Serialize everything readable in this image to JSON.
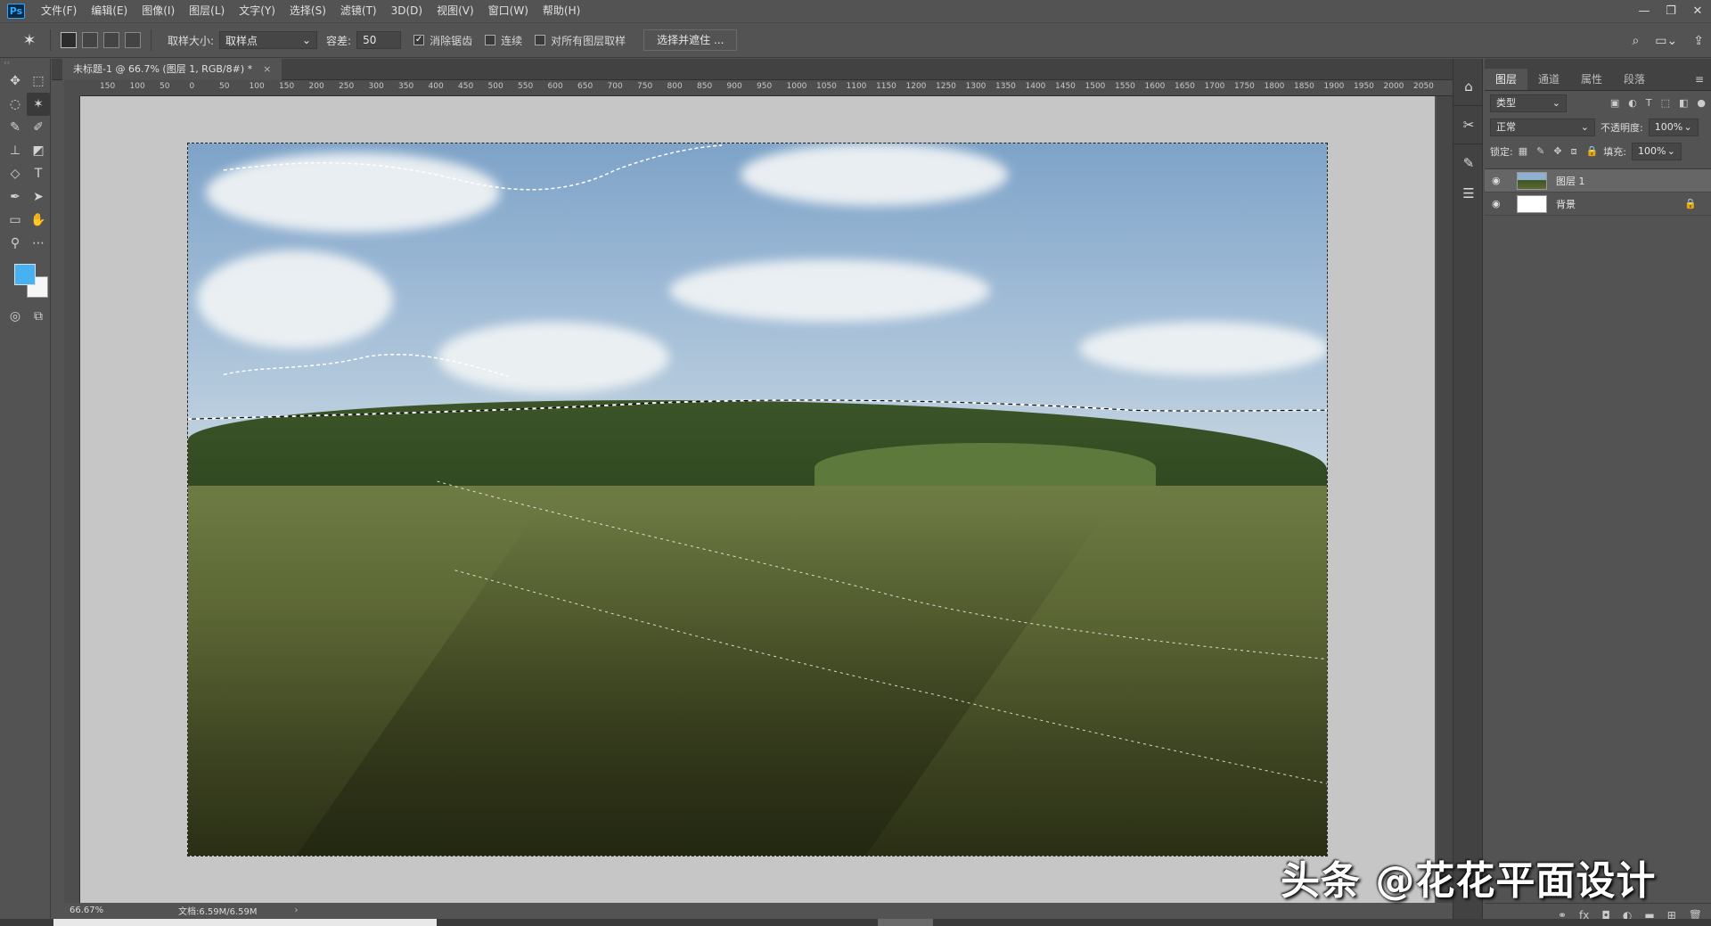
{
  "app": {
    "logo": "Ps"
  },
  "menu": [
    "文件(F)",
    "编辑(E)",
    "图像(I)",
    "图层(L)",
    "文字(Y)",
    "选择(S)",
    "滤镜(T)",
    "3D(D)",
    "视图(V)",
    "窗口(W)",
    "帮助(H)"
  ],
  "window_controls": [
    "—",
    "❐",
    "✕"
  ],
  "options": {
    "sample_size_label": "取样大小:",
    "sample_size_value": "取样点",
    "tolerance_label": "容差:",
    "tolerance_value": "50",
    "antialias_label": "消除锯齿",
    "antialias_checked": true,
    "contiguous_label": "连续",
    "contiguous_checked": false,
    "sample_all_label": "对所有图层取样",
    "sample_all_checked": false,
    "select_mask_button": "选择并遮住 ..."
  },
  "document": {
    "tab_title": "未标题-1 @ 66.7% (图层 1, RGB/8#) *",
    "close": "×"
  },
  "ruler_labels": [
    "150",
    "100",
    "50",
    "0",
    "50",
    "100",
    "150",
    "200",
    "250",
    "300",
    "350",
    "400",
    "450",
    "500",
    "550",
    "600",
    "650",
    "700",
    "750",
    "800",
    "850",
    "900",
    "950",
    "1000",
    "1050",
    "1100",
    "1150",
    "1200",
    "1250",
    "1300",
    "1350",
    "1400",
    "1450",
    "1500",
    "1550",
    "1600",
    "1650",
    "1700",
    "1750",
    "1800",
    "1850",
    "1900",
    "1950",
    "2000",
    "2050"
  ],
  "panels": {
    "tabs": [
      "图层",
      "通道",
      "属性",
      "段落"
    ],
    "filter_kind": "类型",
    "blend_mode": "正常",
    "opacity_label": "不透明度:",
    "opacity_value": "100%",
    "lock_label": "锁定:",
    "fill_label": "填充:",
    "fill_value": "100%",
    "layers": [
      {
        "name": "图层 1",
        "selected": true,
        "locked": false
      },
      {
        "name": "背景",
        "selected": false,
        "locked": true
      }
    ],
    "bottom_icons": [
      "link-icon",
      "fx-icon",
      "mask-icon",
      "adjustment-icon",
      "folder-icon",
      "new-layer-icon",
      "trash-icon"
    ]
  },
  "status": {
    "zoom": "66.67%",
    "doc_info": "文档:6.59M/6.59M",
    "arrow": "›"
  },
  "colors": {
    "foreground": "#47b2f2",
    "background": "#f6f6f6"
  },
  "watermark": "头条 @花花平面设计"
}
